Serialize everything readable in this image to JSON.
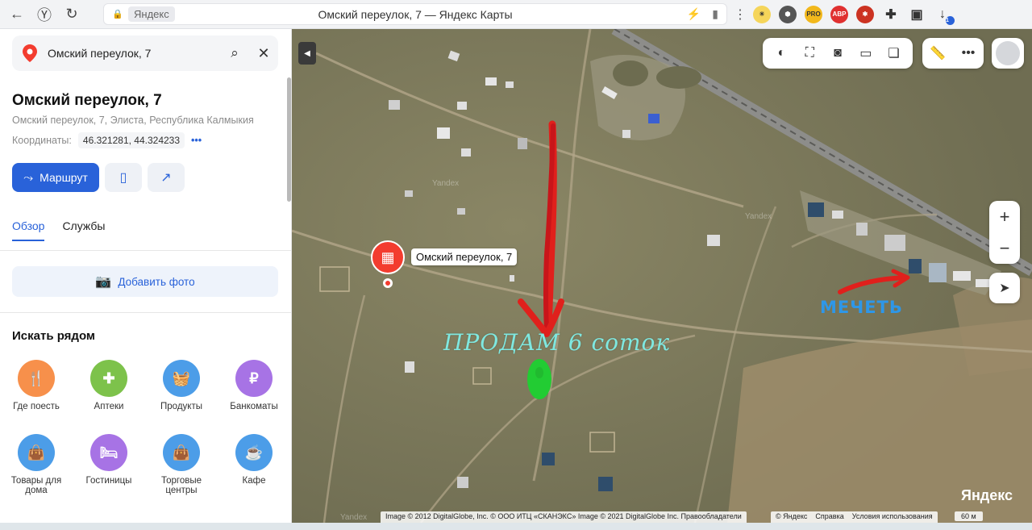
{
  "browser": {
    "host": "Яндекс",
    "title": "Омский переулок, 7 — Яндекс Карты",
    "ext_pro": "PRO",
    "ext_abp": "ABP",
    "download_badge": "1"
  },
  "search": {
    "query": "Омский переулок, 7"
  },
  "place": {
    "title": "Омский переулок, 7",
    "address": "Омский переулок, 7, Элиста, Республика Калмыкия",
    "coords_label": "Координаты:",
    "coords_value": "46.321281, 44.324233",
    "coords_more": "•••"
  },
  "actions": {
    "route_label": "Маршрут"
  },
  "tabs": [
    {
      "label": "Обзор",
      "active": true
    },
    {
      "label": "Службы",
      "active": false
    }
  ],
  "add_photo_label": "Добавить фото",
  "nearby": {
    "title": "Искать рядом",
    "categories": [
      {
        "label": "Где поесть",
        "color": "#f7904b",
        "icon": "fork-knife-icon"
      },
      {
        "label": "Аптеки",
        "color": "#7dc24b",
        "icon": "pharmacy-cross-icon"
      },
      {
        "label": "Продукты",
        "color": "#4c9de8",
        "icon": "basket-icon"
      },
      {
        "label": "Банкоматы",
        "color": "#a773e5",
        "icon": "ruble-icon"
      },
      {
        "label": "Товары для дома",
        "color": "#4c9de8",
        "icon": "shopping-bag-icon"
      },
      {
        "label": "Гостиницы",
        "color": "#a773e5",
        "icon": "bed-icon"
      },
      {
        "label": "Торговые центры",
        "color": "#4c9de8",
        "icon": "shopping-bag-icon"
      },
      {
        "label": "Кафе",
        "color": "#4c9de8",
        "icon": "coffee-cup-icon"
      }
    ]
  },
  "map": {
    "place_label": "Омский переулок, 7",
    "sell_label": "ПРОДАМ 6 соток",
    "mosque_label": "МЕЧЕТЬ",
    "attribution": "Image © 2012 DigitalGlobe, Inc. © ООО ИТЦ «СКАНЭКС» Image © 2021 DigitalGlobe Inc.   Правообладатели",
    "links": [
      "© Яндекс",
      "Справка",
      "Условия использования"
    ],
    "brand": "Яндекс",
    "scale": "60 м",
    "watermark": "Yandex"
  },
  "colors": {
    "accent": "#2962d9",
    "pin": "#f33c2f",
    "arrow": "#e0201c",
    "marker": "#22cc33"
  }
}
